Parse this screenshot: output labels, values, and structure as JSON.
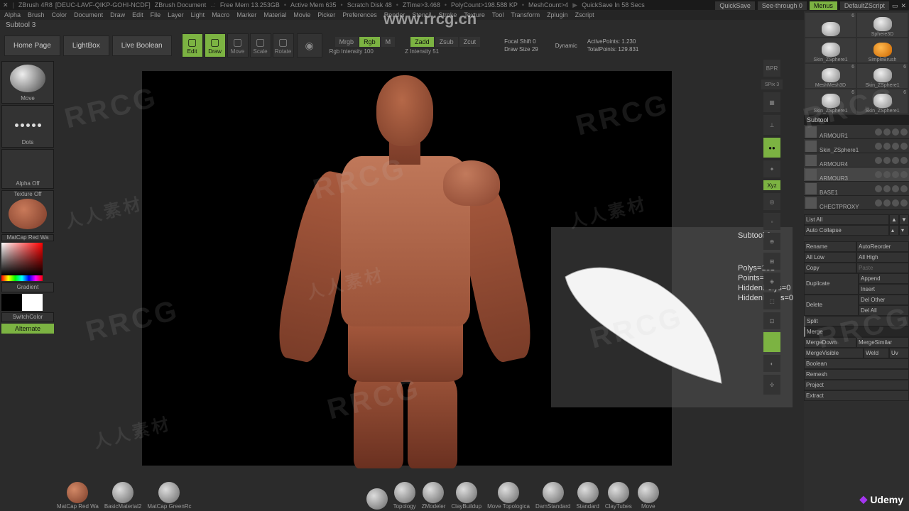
{
  "title": {
    "app": "ZBrush 4R8",
    "project": "[DEUC-LAVF-QIKP-GOHI-NCDF]",
    "doc": "ZBrush Document",
    "free_mem": "Free Mem 13.253GB",
    "active_mem": "Active Mem 635",
    "scratch": "Scratch Disk 48",
    "ztime": "ZTime>3.468",
    "polycount": "PolyCount>198.588 KP",
    "meshcount": "MeshCount>4",
    "quicksave": "QuickSave In 58 Secs"
  },
  "top_right": {
    "quicksave": "QuickSave",
    "seethrough": "See-through  0",
    "menus": "Menus",
    "default": "DefaultZScript"
  },
  "menus": [
    "Alpha",
    "Brush",
    "Color",
    "Document",
    "Draw",
    "Edit",
    "File",
    "Layer",
    "Light",
    "Macro",
    "Marker",
    "Material",
    "Movie",
    "Picker",
    "Preferences",
    "Render",
    "Stencil",
    "Stroke",
    "Texture",
    "Tool",
    "Transform",
    "Zplugin",
    "Zscript"
  ],
  "subtitle": "Subtool 3",
  "nav": {
    "home": "Home Page",
    "lightbox": "LightBox",
    "boolean": "Live Boolean"
  },
  "edit_tools": [
    {
      "label": "Edit",
      "active": true
    },
    {
      "label": "Draw",
      "active": true
    },
    {
      "label": "Move",
      "active": false
    },
    {
      "label": "Scale",
      "active": false
    },
    {
      "label": "Rotate",
      "active": false
    }
  ],
  "modes": {
    "row1": [
      {
        "label": "Mrgb",
        "active": false
      },
      {
        "label": "Rgb",
        "active": true
      },
      {
        "label": "M",
        "active": false
      }
    ],
    "row1_slider": "Rgb Intensity 100",
    "row2": [
      {
        "label": "Zadd",
        "active": true
      },
      {
        "label": "Zsub",
        "active": false
      },
      {
        "label": "Zcut",
        "active": false
      }
    ],
    "row2_slider": "Z Intensity 51"
  },
  "focal": {
    "shift": "Focal Shift 0",
    "draw": "Draw Size 29",
    "dynamic": "Dynamic"
  },
  "points": {
    "active": "ActivePoints: 1.230",
    "total": "TotalPoints: 129.831"
  },
  "left": {
    "brush": "Move",
    "stroke": "Dots",
    "alpha": "Alpha Off",
    "texture": "Texture Off",
    "material": "MatCap Red Wa",
    "gradient": "Gradient",
    "switch": "SwitchColor",
    "alternate": "Alternate"
  },
  "tooltip": {
    "title": "Subtool 3",
    "polys": "Polys=181",
    "points": "Points=178",
    "hpolys": "HiddenPolys=0",
    "hpoints": "HiddenPoints=0"
  },
  "right_tools": {
    "spix": "SPix 3",
    "persp": "Persp",
    "floor": "Floor",
    "local": "Local",
    "xyz": "Xyz"
  },
  "tools_grid": [
    {
      "name": "",
      "count": "6"
    },
    {
      "name": "Sphere3D",
      "count": ""
    },
    {
      "name": "Skin_ZSphere1",
      "count": ""
    },
    {
      "name": "SimpleBrush",
      "count": ""
    },
    {
      "name": "MeshMesh3D",
      "count": "6"
    },
    {
      "name": "Skin_ZSphere1",
      "count": "6"
    },
    {
      "name": "Skin_ZSphere1",
      "count": "6"
    },
    {
      "name": "Skin_ZSphere1",
      "count": "6"
    }
  ],
  "subtool_header": "Subtool",
  "subtools": [
    {
      "name": "ARMOUR1"
    },
    {
      "name": "Skin_ZSphere1"
    },
    {
      "name": "ARMOUR4"
    },
    {
      "name": "ARMOUR3"
    },
    {
      "name": "BASE1"
    },
    {
      "name": "CHECTPROXY"
    }
  ],
  "panel": {
    "listall": "List All",
    "autocollapse": "Auto Collapse",
    "rename": "Rename",
    "autoreorder": "AutoReorder",
    "alllow": "All Low",
    "allhigh": "All High",
    "copy": "Copy",
    "paste": "Paste",
    "duplicate": "Duplicate",
    "append": "Append",
    "insert": "Insert",
    "delete": "Delete",
    "delother": "Del Other",
    "delall": "Del All",
    "split": "Split",
    "merge": "Merge",
    "mergedown": "MergeDown",
    "mergesimilar": "MergeSimilar",
    "mergevisible": "MergeVisible",
    "weld": "Weld",
    "uv": "Uv",
    "boolean": "Boolean",
    "remesh": "Remesh",
    "project": "Project",
    "extract": "Extract"
  },
  "bottom_brushes": [
    "MatCap Red Wa",
    "BasicMaterial2",
    "MatCap GreenRc",
    "",
    "Topology",
    "ZModeler",
    "ClayBuildup",
    "Move Topologica",
    "DamStandard",
    "Standard",
    "ClayTubes",
    "Move"
  ],
  "branding": {
    "udemy": "Udemy",
    "url": "www.rrcg.cn"
  }
}
